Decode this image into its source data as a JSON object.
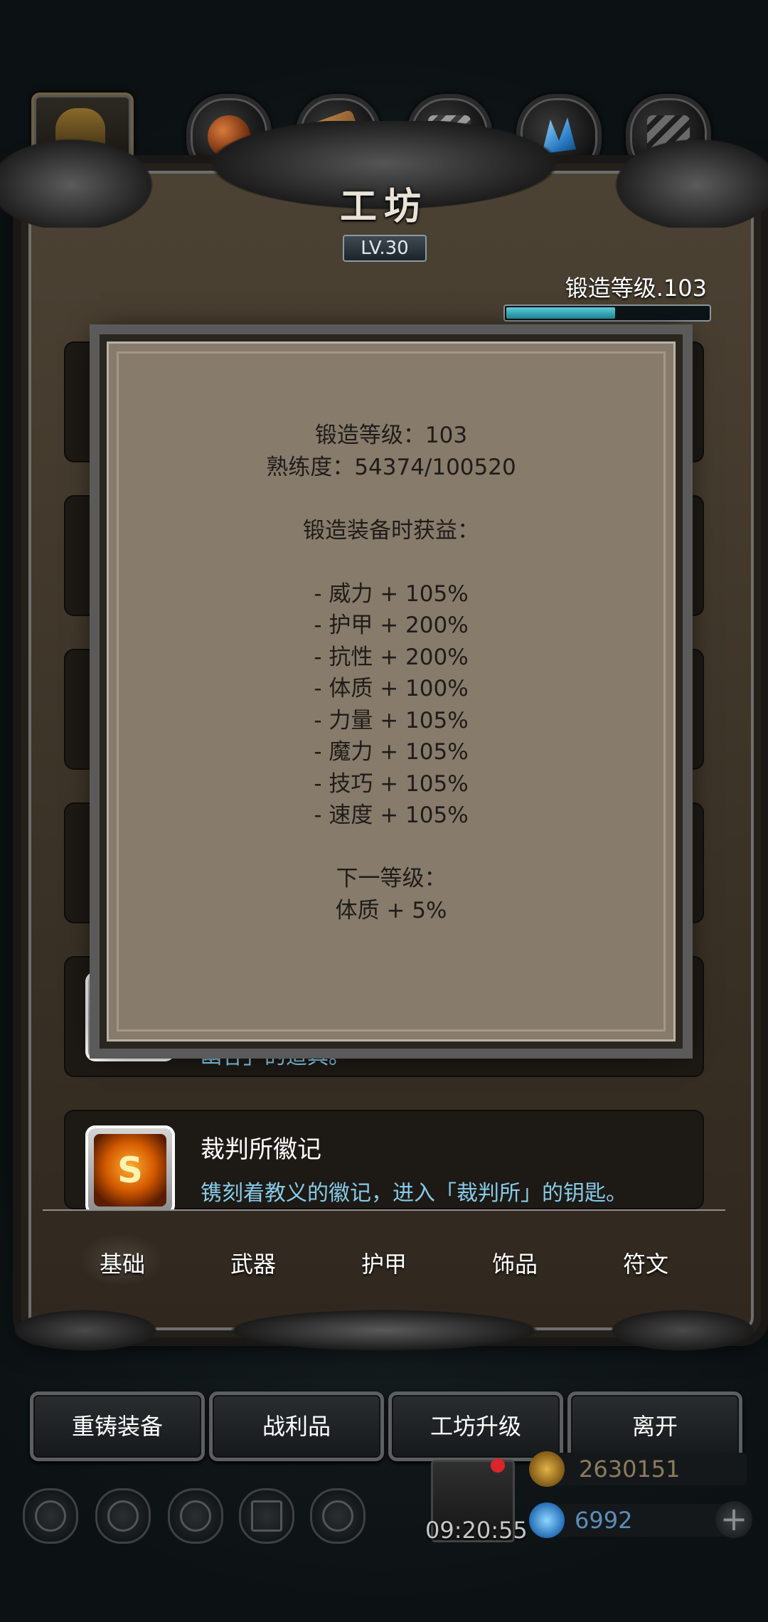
{
  "header": {
    "title": "工坊",
    "level_badge": "LV.30",
    "forge_level_label": "锻造等级.103",
    "forge_progress": 0.54
  },
  "category_tabs": [
    {
      "icon": "hooded-figure-icon",
      "active": true
    },
    {
      "icon": "ore-balls-icon"
    },
    {
      "icon": "wood-planks-icon"
    },
    {
      "icon": "metal-bars-icon"
    },
    {
      "icon": "blue-crystal-icon"
    },
    {
      "icon": "dark-metal-icon"
    }
  ],
  "list_items": [
    {
      "name": "",
      "desc": "幽谷」的道具。",
      "icon": "fire-emblem-icon"
    },
    {
      "name": "裁判所徽记",
      "desc": "镌刻着教义的徽记，进入「裁判所」的钥匙。",
      "icon": "judgment-emblem-icon",
      "glyph": "S"
    }
  ],
  "popup": {
    "lines": [
      "锻造等级：103",
      "熟练度：54374/100520",
      "",
      "锻造装备时获益：",
      "",
      "- 威力 + 105%",
      "- 护甲 + 200%",
      "- 抗性 + 200%",
      "- 体质 + 100%",
      "- 力量 + 105%",
      "- 魔力 + 105%",
      "- 技巧 + 105%",
      "- 速度 + 105%",
      "",
      "下一等级：",
      "体质 + 5%"
    ]
  },
  "bottom_tabs": [
    "基础",
    "武器",
    "护甲",
    "饰品",
    "符文"
  ],
  "actions": [
    "重铸装备",
    "战利品",
    "工坊升级",
    "离开"
  ],
  "status": {
    "timer": "09:20:55",
    "gold": "2630151",
    "gems": "6992"
  }
}
